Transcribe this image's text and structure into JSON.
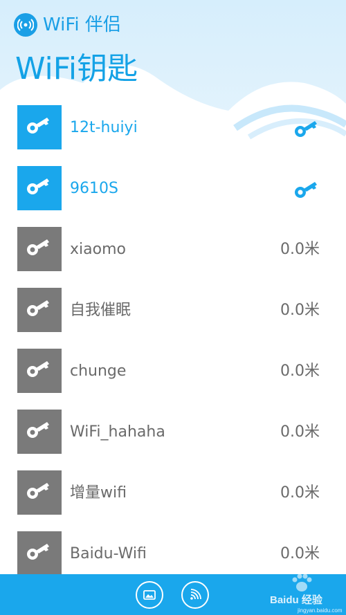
{
  "header": {
    "app_title": "WiFi 伴侣",
    "logo_icon": "wifi-signal-icon"
  },
  "page": {
    "title": "WiFi钥匙"
  },
  "colors": {
    "accent": "#1aa7ec",
    "inactive_tile": "#7a7a7a",
    "text_inactive": "#6a6a6a",
    "sky": "#d6eefc"
  },
  "networks": [
    {
      "name": "12t-huiyi",
      "status": "active",
      "distance": "",
      "status_icon": "key-icon"
    },
    {
      "name": "9610S",
      "status": "active",
      "distance": "",
      "status_icon": "key-icon"
    },
    {
      "name": "xiaomo",
      "status": "inactive",
      "distance": "0.0米"
    },
    {
      "name": "自我催眠",
      "status": "inactive",
      "distance": "0.0米"
    },
    {
      "name": "chunge",
      "status": "inactive",
      "distance": "0.0米"
    },
    {
      "name": "WiFi_hahaha",
      "status": "inactive",
      "distance": "0.0米"
    },
    {
      "name": "增量wifi",
      "status": "inactive",
      "distance": "0.0米"
    },
    {
      "name": "Baidu-Wifi",
      "status": "inactive",
      "distance": "0.0米"
    }
  ],
  "app_bar": {
    "buttons": [
      {
        "icon": "image-icon"
      },
      {
        "icon": "wifi-icon"
      }
    ]
  },
  "watermark": {
    "brand": "Baidu 经验",
    "url": "jingyan.baidu.com"
  }
}
